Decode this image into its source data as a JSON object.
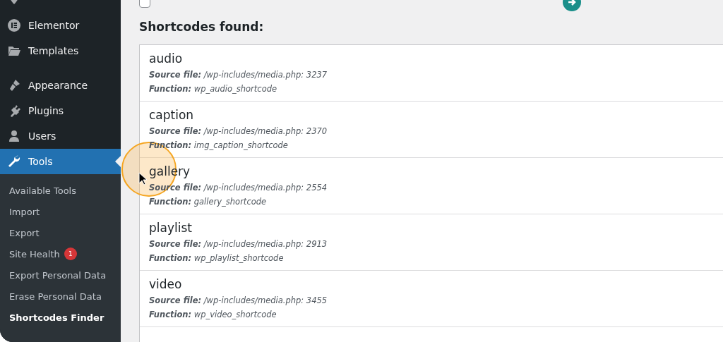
{
  "sidebar": {
    "groups": [
      {
        "items": [
          {
            "label": "Elementor",
            "selected": false
          },
          {
            "label": "Templates",
            "selected": false
          }
        ]
      },
      {
        "items": [
          {
            "label": "Appearance",
            "selected": false
          },
          {
            "label": "Plugins",
            "selected": false
          },
          {
            "label": "Users",
            "selected": false
          },
          {
            "label": "Tools",
            "selected": true
          }
        ]
      }
    ],
    "submenu": [
      {
        "label": "Available Tools",
        "selected": false
      },
      {
        "label": "Import",
        "selected": false
      },
      {
        "label": "Export",
        "selected": false
      },
      {
        "label": "Site Health",
        "selected": false,
        "badge": "1"
      },
      {
        "label": "Export Personal Data",
        "selected": false
      },
      {
        "label": "Erase Personal Data",
        "selected": false
      },
      {
        "label": "Shortcodes Finder",
        "selected": true
      }
    ]
  },
  "options": {
    "checked": false
  },
  "heading": "Shortcodes found:",
  "shortcodes": [
    {
      "name": "audio",
      "source_label": "Source file:",
      "source": "/wp-includes/media.php: 3237",
      "function_label": "Function:",
      "function": "wp_audio_shortcode"
    },
    {
      "name": "caption",
      "source_label": "Source file:",
      "source": "/wp-includes/media.php: 2370",
      "function_label": "Function:",
      "function": "img_caption_shortcode"
    },
    {
      "name": "gallery",
      "source_label": "Source file:",
      "source": "/wp-includes/media.php: 2554",
      "function_label": "Function:",
      "function": "gallery_shortcode"
    },
    {
      "name": "playlist",
      "source_label": "Source file:",
      "source": "/wp-includes/media.php: 2913",
      "function_label": "Function:",
      "function": "wp_playlist_shortcode"
    },
    {
      "name": "video",
      "source_label": "Source file:",
      "source": "/wp-includes/media.php: 3455",
      "function_label": "Function:",
      "function": "wp_video_shortcode"
    }
  ]
}
